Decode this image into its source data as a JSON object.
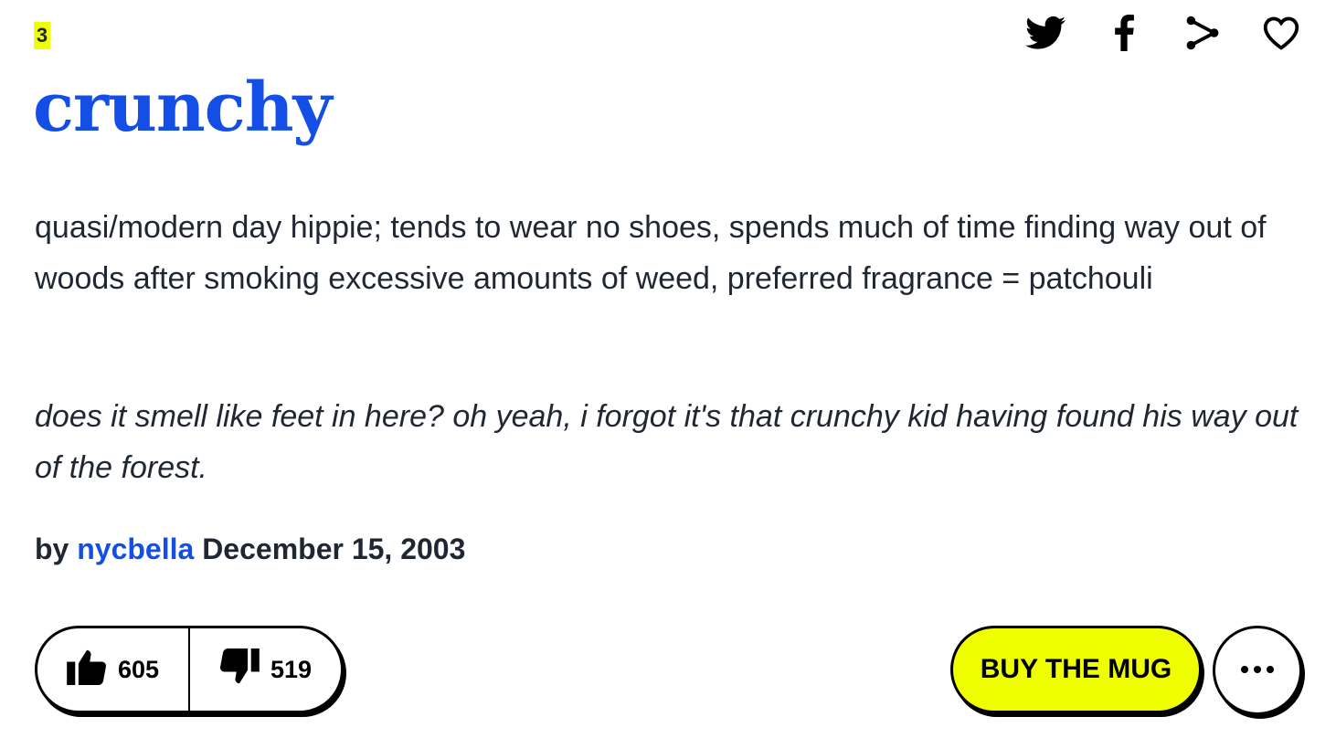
{
  "entry": {
    "rank": "3",
    "word": "crunchy",
    "meaning": "quasi/modern day hippie; tends to wear no shoes, spends much of time finding way out of woods after smoking excessive amounts of weed, preferred fragrance = patchouli",
    "example": "does it smell like feet in here? oh yeah, i forgot it's that crunchy kid having found his way out of the forest.",
    "by_label": "by",
    "author": "nycbella",
    "date": "December 15, 2003"
  },
  "share_icons": [
    "twitter-icon",
    "facebook-icon",
    "share-icon",
    "heart-icon"
  ],
  "votes": {
    "up": "605",
    "down": "519"
  },
  "buttons": {
    "buy_mug": "BUY THE MUG"
  },
  "colors": {
    "accent_blue": "#134fe6",
    "highlight_yellow": "#efff00",
    "text": "#1f2733"
  }
}
